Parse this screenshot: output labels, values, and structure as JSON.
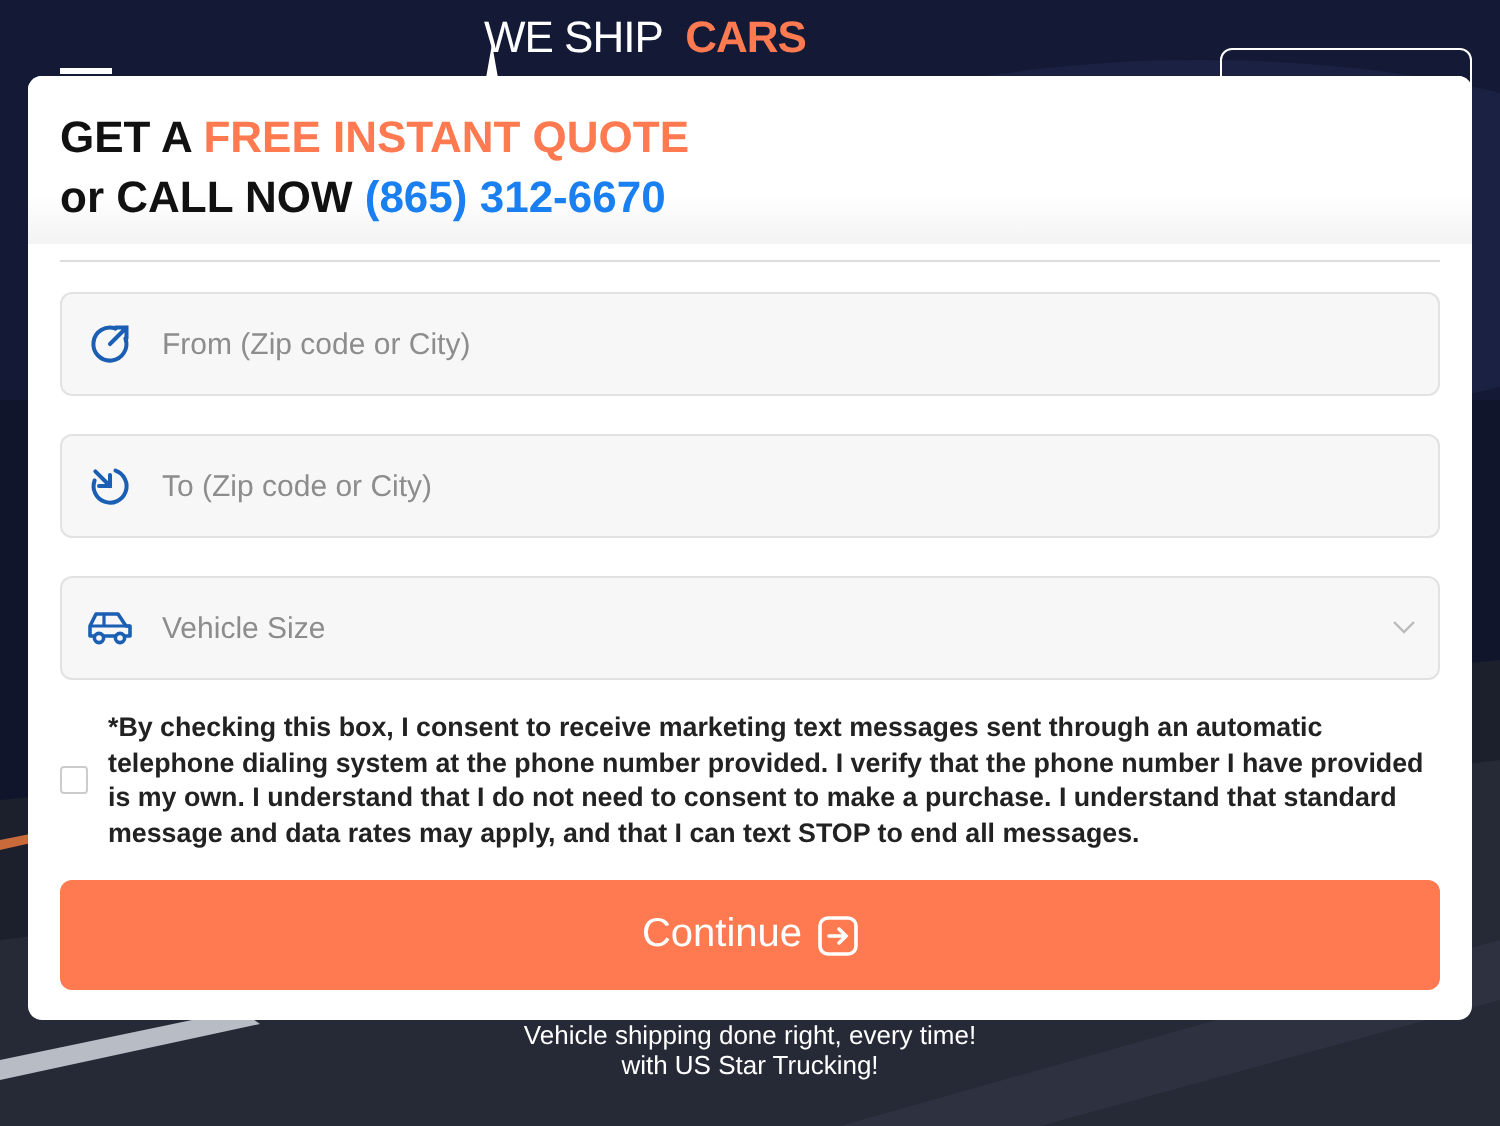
{
  "header": {
    "logo_prefix": "WE SHIP",
    "logo_highlight": "CARS"
  },
  "background": {
    "kind": "picture"
  },
  "quote_form": {
    "heading_lead": "GET A",
    "heading_highlight": "FREE INSTANT QUOTE",
    "call_lead": "or CALL NOW",
    "phone": "(865) 312-6670",
    "fields": [
      {
        "kind": "origin",
        "placeholder": "From (Zip code or City)"
      },
      {
        "kind": "destination",
        "placeholder": "To (Zip code or City)"
      },
      {
        "kind": "vehicle",
        "placeholder": "Vehicle Size"
      }
    ],
    "consent": {
      "checked": false,
      "text": "*By checking this box, I consent to receive marketing text messages sent through an automatic telephone dialing system at the phone number provided. I verify that the phone number I have provided is my own. I understand that I do not need to consent to make a purchase. I understand that standard message and data rates may apply, and that I can text STOP to end all messages."
    },
    "submit": "Continue"
  },
  "tagline": [
    "Vehicle shipping done right, every time!",
    "with US Star Trucking!"
  ]
}
